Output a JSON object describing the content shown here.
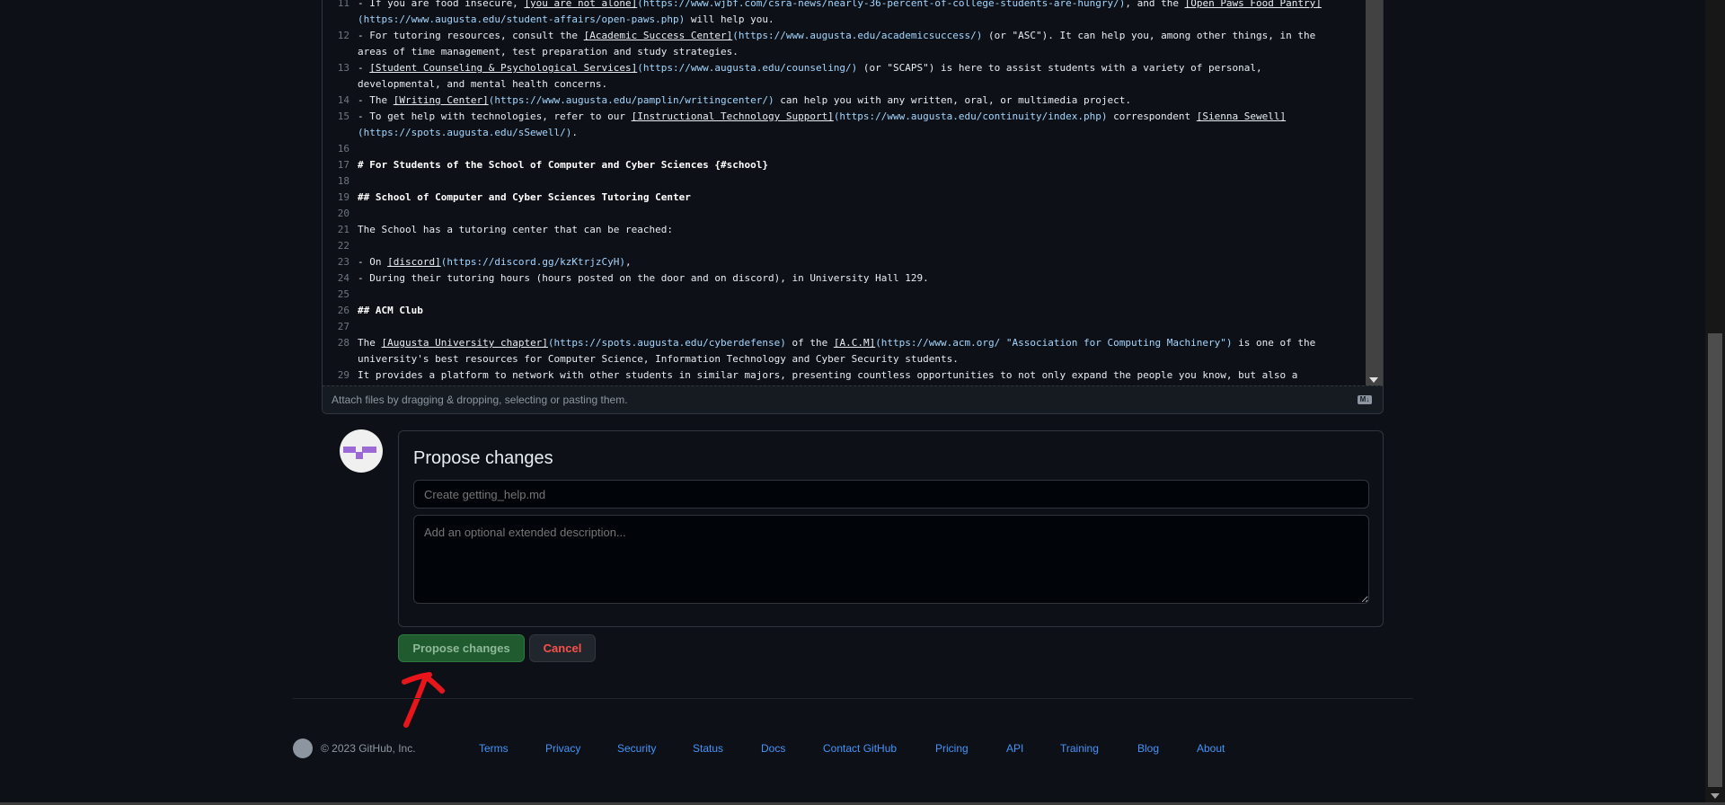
{
  "editor": {
    "rows": [
      {
        "n": "11",
        "s": [
          {
            "t": "- If you are food insecure, ",
            "k": "txt"
          },
          {
            "t": "[you are not alone]",
            "k": "lnk"
          },
          {
            "t": "(https://www.wjbf.com/csra-news/nearly-36-percent-of-college-students-are-hungry/)",
            "k": "url"
          },
          {
            "t": ", and the ",
            "k": "txt"
          },
          {
            "t": "[Open Paws Food Pantry]",
            "k": "lnk"
          }
        ]
      },
      {
        "n": "",
        "s": [
          {
            "t": "(https://www.augusta.edu/student-affairs/open-paws.php)",
            "k": "url"
          },
          {
            "t": " will help you.",
            "k": "txt"
          }
        ]
      },
      {
        "n": "12",
        "s": [
          {
            "t": "- For tutoring resources, consult the ",
            "k": "txt"
          },
          {
            "t": "[Academic Success Center]",
            "k": "lnk"
          },
          {
            "t": "(https://www.augusta.edu/academicsuccess/)",
            "k": "url"
          },
          {
            "t": " (or \"ASC\"). It can help you, among other things, in the",
            "k": "txt"
          }
        ]
      },
      {
        "n": "",
        "s": [
          {
            "t": "areas of time management, test preparation and study strategies.",
            "k": "txt"
          }
        ]
      },
      {
        "n": "13",
        "s": [
          {
            "t": "- ",
            "k": "txt"
          },
          {
            "t": "[Student Counseling & Psychological Services]",
            "k": "lnk"
          },
          {
            "t": "(https://www.augusta.edu/counseling/)",
            "k": "url"
          },
          {
            "t": " (or \"SCAPS\") is here to assist students with a variety of personal,",
            "k": "txt"
          }
        ]
      },
      {
        "n": "",
        "s": [
          {
            "t": "developmental, and mental health concerns.",
            "k": "txt"
          }
        ]
      },
      {
        "n": "14",
        "s": [
          {
            "t": "- The ",
            "k": "txt"
          },
          {
            "t": "[Writing Center]",
            "k": "lnk"
          },
          {
            "t": "(https://www.augusta.edu/pamplin/writingcenter/)",
            "k": "url"
          },
          {
            "t": " can help you with any written, oral, or multimedia project.",
            "k": "txt"
          }
        ]
      },
      {
        "n": "15",
        "s": [
          {
            "t": "- To get help with technologies, refer to our ",
            "k": "txt"
          },
          {
            "t": "[Instructional Technology Support]",
            "k": "lnk"
          },
          {
            "t": "(https://www.augusta.edu/continuity/index.php)",
            "k": "url"
          },
          {
            "t": " correspondent ",
            "k": "txt"
          },
          {
            "t": "[Sienna Sewell]",
            "k": "lnk"
          }
        ]
      },
      {
        "n": "",
        "s": [
          {
            "t": "(https://spots.augusta.edu/sSewell/)",
            "k": "url"
          },
          {
            "t": ".",
            "k": "txt"
          }
        ]
      },
      {
        "n": "16",
        "s": []
      },
      {
        "n": "17",
        "s": [
          {
            "t": "# For Students of the School of Computer and Cyber Sciences {#school}",
            "k": "h"
          }
        ]
      },
      {
        "n": "18",
        "s": []
      },
      {
        "n": "19",
        "s": [
          {
            "t": "## School of Computer and Cyber Sciences Tutoring Center",
            "k": "h"
          }
        ]
      },
      {
        "n": "20",
        "s": []
      },
      {
        "n": "21",
        "s": [
          {
            "t": "The School has a tutoring center that can be reached:",
            "k": "txt"
          }
        ]
      },
      {
        "n": "22",
        "s": []
      },
      {
        "n": "23",
        "s": [
          {
            "t": "- On ",
            "k": "txt"
          },
          {
            "t": "[discord]",
            "k": "lnk"
          },
          {
            "t": "(https://discord.gg/kzKtrjzCyH)",
            "k": "url"
          },
          {
            "t": ",",
            "k": "txt"
          }
        ]
      },
      {
        "n": "24",
        "s": [
          {
            "t": "- During their tutoring hours (hours posted on the door and on discord), in University Hall 129.",
            "k": "txt"
          }
        ]
      },
      {
        "n": "25",
        "s": []
      },
      {
        "n": "26",
        "s": [
          {
            "t": "## ACM Club",
            "k": "h"
          }
        ]
      },
      {
        "n": "27",
        "s": []
      },
      {
        "n": "28",
        "s": [
          {
            "t": "The ",
            "k": "txt"
          },
          {
            "t": "[Augusta University chapter]",
            "k": "lnk"
          },
          {
            "t": "(https://spots.augusta.edu/cyberdefense)",
            "k": "url"
          },
          {
            "t": " of the ",
            "k": "txt"
          },
          {
            "t": "[A.C.M]",
            "k": "lnk"
          },
          {
            "t": "(https://www.acm.org/ \"Association for Computing Machinery\")",
            "k": "url"
          },
          {
            "t": " is one of the",
            "k": "txt"
          }
        ]
      },
      {
        "n": "",
        "s": [
          {
            "t": "university's best resources for Computer Science, Information Technology and Cyber Security students.",
            "k": "txt"
          }
        ]
      },
      {
        "n": "29",
        "s": [
          {
            "t": "It provides a platform to network with other students in similar majors, presenting countless opportunities to not only expand the people you know, but also a",
            "k": "txt"
          }
        ]
      }
    ],
    "attach_hint": "Attach files by dragging & dropping, selecting or pasting them.",
    "markdown_badge": "M↓"
  },
  "propose": {
    "title": "Propose changes",
    "summary_placeholder": "Create getting_help.md",
    "description_placeholder": "Add an optional extended description...",
    "submit_label": "Propose changes",
    "cancel_label": "Cancel"
  },
  "footer": {
    "copyright": "© 2023 GitHub, Inc.",
    "links": [
      "Terms",
      "Privacy",
      "Security",
      "Status",
      "Docs",
      "Contact GitHub",
      "Pricing",
      "API",
      "Training",
      "Blog",
      "About"
    ]
  },
  "colors": {
    "accent_green": "#1f5b2e",
    "danger": "#f85149",
    "link": "#4493f8",
    "annotation": "#e8161b"
  }
}
